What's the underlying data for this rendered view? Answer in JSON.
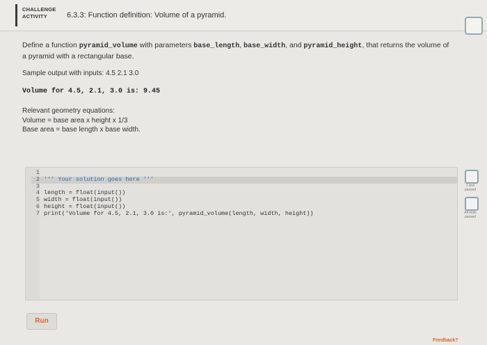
{
  "header": {
    "badge_line1": "CHALLENGE",
    "badge_line2": "ACTIVITY",
    "title": "6.3.3: Function definition: Volume of a pyramid."
  },
  "description": {
    "part1": "Define a function ",
    "func_name": "pyramid_volume",
    "part2": " with parameters ",
    "param1": "base_length",
    "sep1": ", ",
    "param2": "base_width",
    "sep2": ", and ",
    "param3": "pyramid_height",
    "part3": ", that returns the volume of a pyramid with a rectangular base."
  },
  "sample": {
    "label": "Sample output with inputs: 4.5 2.1 3.0",
    "output": "Volume for 4.5, 2.1, 3.0 is: 9.45"
  },
  "geometry": {
    "heading": "Relevant geometry equations:",
    "line1": "Volume = base area x height x 1/3",
    "line2": "Base area = base length x base width."
  },
  "code": {
    "lines": [
      {
        "n": "1",
        "text": ""
      },
      {
        "n": "2",
        "text": "''' Your solution goes here '''"
      },
      {
        "n": "3",
        "text": ""
      },
      {
        "n": "4",
        "text": "length = float(input())"
      },
      {
        "n": "5",
        "text": "width = float(input())"
      },
      {
        "n": "6",
        "text": "height = float(input())"
      },
      {
        "n": "7",
        "text": "print('Volume for 4.5, 2.1, 3.0 is:', pyramid_volume(length, width, height))"
      }
    ]
  },
  "side": {
    "test1_label1": "1 test",
    "test1_label2": "passed",
    "test2_label1": "All tests",
    "test2_label2": "passed"
  },
  "run_label": "Run",
  "feedback_label": "Feedback?"
}
